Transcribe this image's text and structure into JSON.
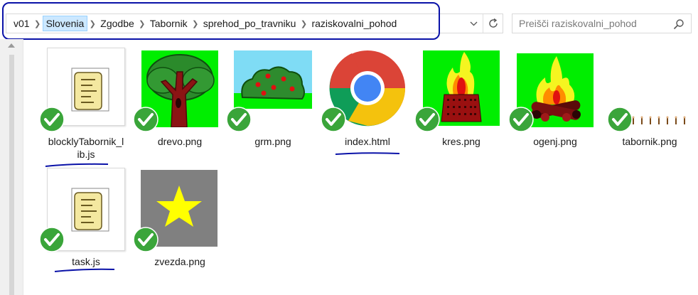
{
  "breadcrumb": {
    "items": [
      "v01",
      "Slovenia",
      "Zgodbe",
      "Tabornik",
      "sprehod_po_travniku",
      "raziskovalni_pohod"
    ],
    "hover_index": 1
  },
  "search": {
    "placeholder": "Preišči raziskovalni_pohod"
  },
  "files": [
    {
      "name": "blocklyTabornik_lib.js",
      "display": [
        "blocklyTabornik_l",
        "ib.js"
      ],
      "icon": "script-file-icon",
      "status": "synced"
    },
    {
      "name": "drevo.png",
      "display": [
        "drevo.png"
      ],
      "icon": "tree-image-icon",
      "status": "synced"
    },
    {
      "name": "grm.png",
      "display": [
        "grm.png"
      ],
      "icon": "bush-image-icon",
      "status": "synced"
    },
    {
      "name": "index.html",
      "display": [
        "index.html"
      ],
      "icon": "chrome-icon",
      "status": "synced"
    },
    {
      "name": "kres.png",
      "display": [
        "kres.png"
      ],
      "icon": "bonfire-image-icon",
      "status": "synced"
    },
    {
      "name": "ogenj.png",
      "display": [
        "ogenj.png"
      ],
      "icon": "campfire-image-icon",
      "status": "synced"
    },
    {
      "name": "tabornik.png",
      "display": [
        "tabornik.png"
      ],
      "icon": "sprite-strip-icon",
      "status": "synced"
    },
    {
      "name": "task.js",
      "display": [
        "task.js"
      ],
      "icon": "script-file-icon",
      "status": "synced"
    },
    {
      "name": "zvezda.png",
      "display": [
        "zvezda.png"
      ],
      "icon": "star-image-icon",
      "status": "synced"
    }
  ],
  "colors": {
    "annotation": "#0a12a8",
    "grass": "#00ee00",
    "check": "#3aa53a"
  }
}
